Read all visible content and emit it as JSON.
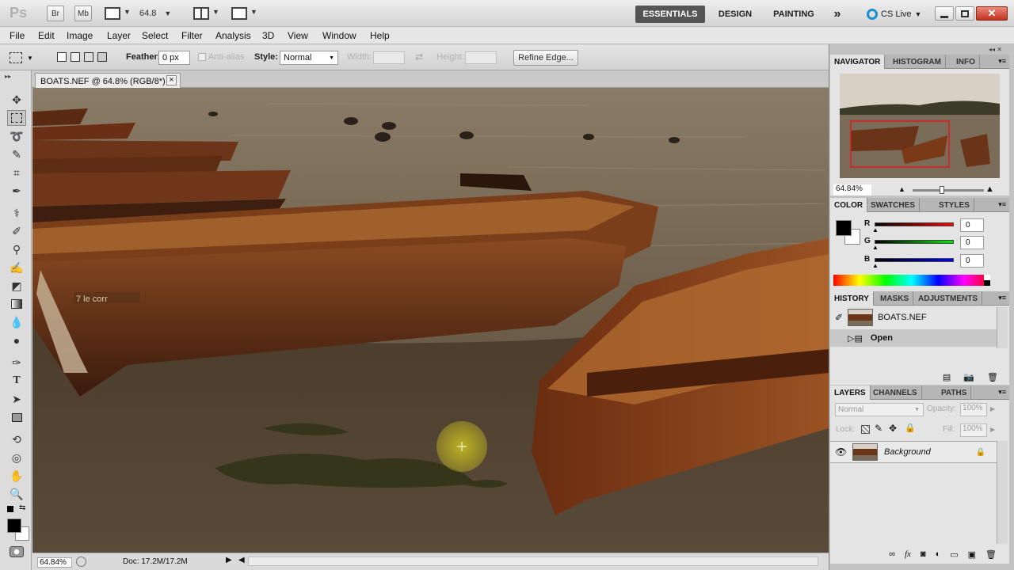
{
  "appbar": {
    "logo": "Ps",
    "bridge_label": "Br",
    "minibridge_label": "Mb",
    "zoom_value": "64.8",
    "workspaces": [
      "ESSENTIALS",
      "DESIGN",
      "PAINTING"
    ],
    "more": "»",
    "cslive": "CS Live",
    "icons": [
      "view-extras-icon",
      "arrange-documents-icon",
      "screen-mode-icon",
      "cs-live-icon",
      "minimize-icon",
      "restore-icon",
      "close-icon"
    ]
  },
  "menu": [
    "File",
    "Edit",
    "Image",
    "Layer",
    "Select",
    "Filter",
    "Analysis",
    "3D",
    "View",
    "Window",
    "Help"
  ],
  "options": {
    "feather_label": "Feather:",
    "feather_value": "0 px",
    "antialias_label": "Anti-alias",
    "style_label": "Style:",
    "style_value": "Normal",
    "width_label": "Width:",
    "height_label": "Height:",
    "refine_edge": "Refine Edge..."
  },
  "document": {
    "tab_title": "BOATS.NEF @ 64.8% (RGB/8*)",
    "close": "×",
    "hull_text": "7 le corr"
  },
  "status": {
    "zoom": "64.84%",
    "doc": "Doc: 17.2M/17.2M"
  },
  "tools": [
    "move-tool",
    "rectangular-marquee-tool",
    "lasso-tool",
    "quick-selection-tool",
    "crop-tool",
    "eyedropper-tool",
    "spot-healing-tool",
    "brush-tool",
    "clone-stamp-tool",
    "history-brush-tool",
    "eraser-tool",
    "gradient-tool",
    "blur-tool",
    "dodge-tool",
    "pen-tool",
    "type-tool",
    "path-selection-tool",
    "rectangle-tool",
    "3d-rotate-tool",
    "3d-orbit-tool",
    "hand-tool",
    "zoom-tool"
  ],
  "navigator": {
    "tabs": [
      "NAVIGATOR",
      "HISTOGRAM",
      "INFO"
    ],
    "zoom": "64.84%"
  },
  "color": {
    "tabs": [
      "COLOR",
      "SWATCHES",
      "STYLES"
    ],
    "r_label": "R",
    "g_label": "G",
    "b_label": "B",
    "r": "0",
    "g": "0",
    "b": "0",
    "colors": {
      "foreground": "#000000",
      "background": "#ffffff"
    }
  },
  "history": {
    "tabs": [
      "HISTORY",
      "MASKS",
      "ADJUSTMENTS"
    ],
    "snapshot": "BOATS.NEF",
    "step": "Open"
  },
  "layers": {
    "tabs": [
      "LAYERS",
      "CHANNELS",
      "PATHS"
    ],
    "blend_mode": "Normal",
    "opacity_label": "Opacity:",
    "opacity_value": "100%",
    "lock_label": "Lock:",
    "fill_label": "Fill:",
    "fill_value": "100%",
    "layer_name": "Background"
  }
}
